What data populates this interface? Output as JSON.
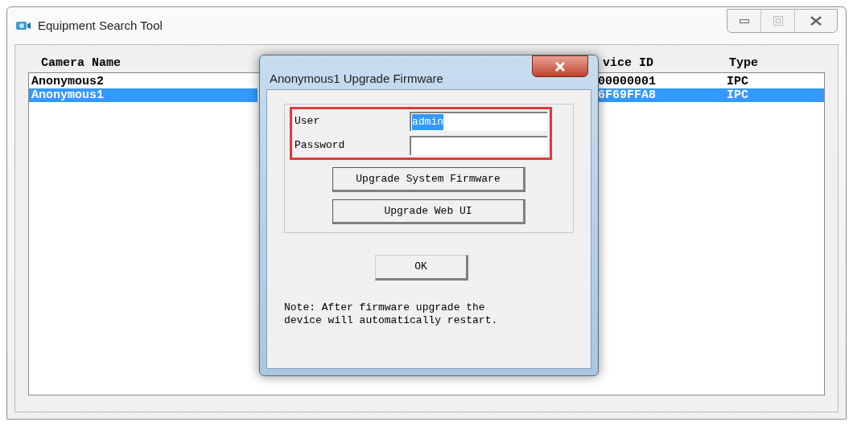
{
  "window": {
    "title": "Equipment Search Tool"
  },
  "list": {
    "columns": [
      "Camera Name",
      "vice ID",
      "Type"
    ],
    "rows": [
      {
        "cells": [
          "Anonymous2",
          "00000001",
          "IPC"
        ],
        "selected": false
      },
      {
        "cells": [
          "Anonymous1",
          "6F69FFA8",
          "IPC"
        ],
        "selected": true
      }
    ]
  },
  "dialog": {
    "title": "Anonymous1 Upgrade Firmware",
    "fields": [
      {
        "label": "User",
        "value": "admin",
        "value_selected": true
      },
      {
        "label": "Password"
      }
    ],
    "buttons": [
      "Upgrade System Firmware",
      "Upgrade Web UI"
    ],
    "ok_button": "OK",
    "note": "Note: After firmware upgrade the device will automatically restart."
  }
}
